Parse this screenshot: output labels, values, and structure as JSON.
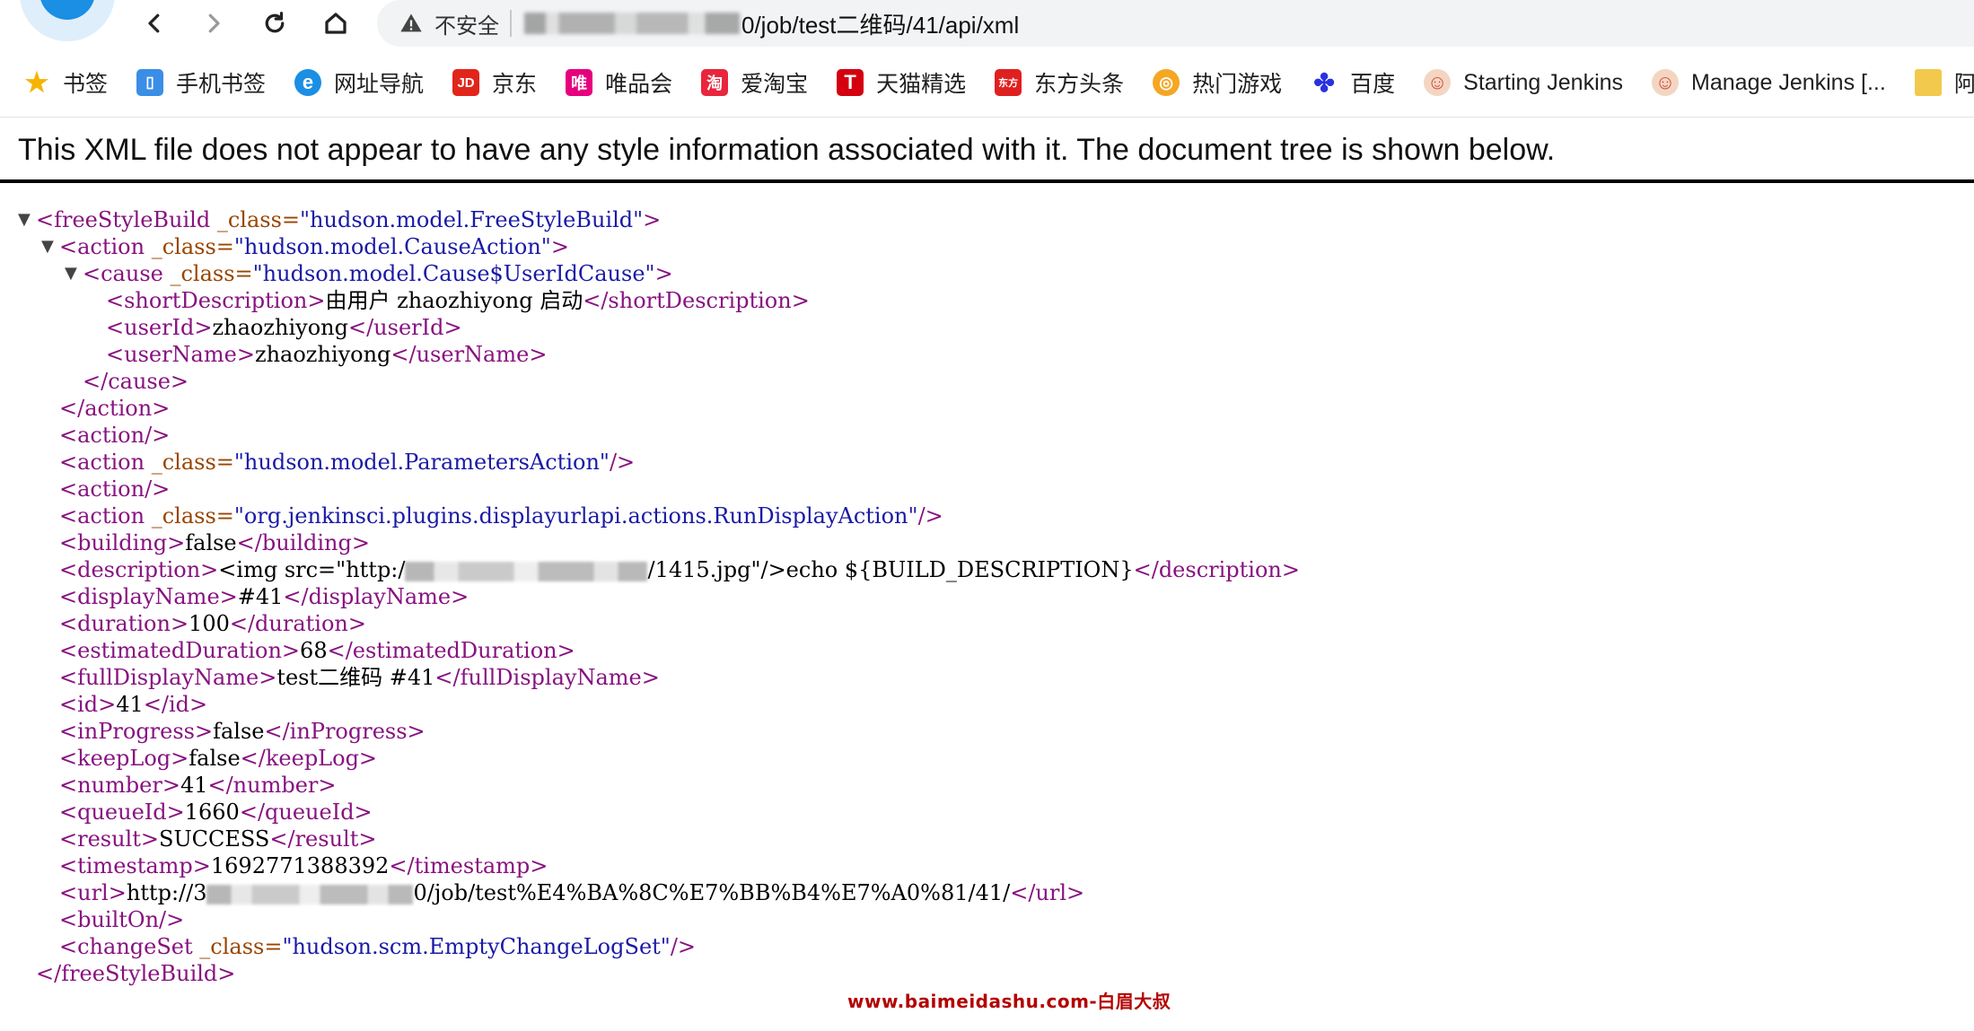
{
  "toolbar": {
    "insecure_label": "不安全",
    "url_path": "0/job/test二维码/41/api/xml"
  },
  "bookmarks": [
    {
      "label": "书签",
      "icon": "star-icon",
      "color": "#f5b400",
      "glyph": "★"
    },
    {
      "label": "手机书签",
      "icon": "phone-icon",
      "color": "#3a8ee6",
      "glyph": "▯"
    },
    {
      "label": "网址导航",
      "icon": "browser-e-icon",
      "color": "#1a8fe3",
      "glyph": "e"
    },
    {
      "label": "京东",
      "icon": "jd-icon",
      "color": "#e1251b",
      "glyph": "JD"
    },
    {
      "label": "唯品会",
      "icon": "vip-icon",
      "color": "#e6007e",
      "glyph": "唯"
    },
    {
      "label": "爱淘宝",
      "icon": "taobao-icon",
      "color": "#e8263d",
      "glyph": "淘"
    },
    {
      "label": "天猫精选",
      "icon": "tmall-icon",
      "color": "#d4000f",
      "glyph": "T"
    },
    {
      "label": "东方头条",
      "icon": "dftt-icon",
      "color": "#e02020",
      "glyph": "东方"
    },
    {
      "label": "热门游戏",
      "icon": "game-icon",
      "color": "#f5a623",
      "glyph": "◎"
    },
    {
      "label": "百度",
      "icon": "baidu-paw-icon",
      "color": "#2932e1",
      "glyph": "✤"
    },
    {
      "label": "Starting Jenkins",
      "icon": "jenkins-icon",
      "color": "#d24939",
      "glyph": "☺"
    },
    {
      "label": "Manage Jenkins [...",
      "icon": "jenkins-icon",
      "color": "#d24939",
      "glyph": "☺"
    },
    {
      "label": "阿里",
      "icon": "folder-icon",
      "color": "#f2c94c",
      "glyph": "▭"
    }
  ],
  "xml_info": "This XML file does not appear to have any style information associated with it. The document tree is shown below.",
  "xml": {
    "root_open": "<freeStyleBuild",
    "attr_class": " _class=",
    "root_class": "\"hudson.model.FreeStyleBuild\"",
    "gt": ">",
    "action_open": "<action",
    "cause_action_class": "\"hudson.model.CauseAction\"",
    "cause_open": "<cause",
    "cause_class": "\"hudson.model.Cause$UserIdCause\"",
    "shortDescription_open": "<shortDescription>",
    "shortDescription_text": "由用户 zhaozhiyong 启动",
    "shortDescription_close": "</shortDescription>",
    "userId_open": "<userId>",
    "userId_text": "zhaozhiyong",
    "userId_close": "</userId>",
    "userName_open": "<userName>",
    "userName_text": "zhaozhiyong",
    "userName_close": "</userName>",
    "cause_close": "</cause>",
    "action_close": "</action>",
    "action_empty": "<action/>",
    "params_class": "\"hudson.model.ParametersAction\"",
    "selfclose": "/>",
    "run_display_class": "\"org.jenkinsci.plugins.displayurlapi.actions.RunDisplayAction\"",
    "building_open": "<building>",
    "building_text": "false",
    "building_close": "</building>",
    "description_open": "<description>",
    "description_text_a": "<img src=\"http:/",
    "description_text_b": "/1415.jpg\"/>echo ${BUILD_DESCRIPTION}",
    "description_close": "</description>",
    "displayName_open": "<displayName>",
    "displayName_text": "#41",
    "displayName_close": "</displayName>",
    "duration_open": "<duration>",
    "duration_text": "100",
    "duration_close": "</duration>",
    "estimatedDuration_open": "<estimatedDuration>",
    "estimatedDuration_text": "68",
    "estimatedDuration_close": "</estimatedDuration>",
    "fullDisplayName_open": "<fullDisplayName>",
    "fullDisplayName_text": "test二维码 #41",
    "fullDisplayName_close": "</fullDisplayName>",
    "id_open": "<id>",
    "id_text": "41",
    "id_close": "</id>",
    "inProgress_open": "<inProgress>",
    "inProgress_text": "false",
    "inProgress_close": "</inProgress>",
    "keepLog_open": "<keepLog>",
    "keepLog_text": "false",
    "keepLog_close": "</keepLog>",
    "number_open": "<number>",
    "number_text": "41",
    "number_close": "</number>",
    "queueId_open": "<queueId>",
    "queueId_text": "1660",
    "queueId_close": "</queueId>",
    "result_open": "<result>",
    "result_text": "SUCCESS",
    "result_close": "</result>",
    "timestamp_open": "<timestamp>",
    "timestamp_text": "1692771388392",
    "timestamp_close": "</timestamp>",
    "url_open": "<url>",
    "url_text_a": "http://3",
    "url_text_b": "0/job/test%E4%BA%8C%E7%BB%B4%E7%A0%81/41/",
    "url_close": "</url>",
    "builtOn_empty": "<builtOn/>",
    "changeSet_open": "<changeSet",
    "changeSet_class": "\"hudson.scm.EmptyChangeLogSet\"",
    "root_close": "</freeStyleBuild>"
  },
  "watermark": "www.baimeidashu.com-白眉大叔"
}
